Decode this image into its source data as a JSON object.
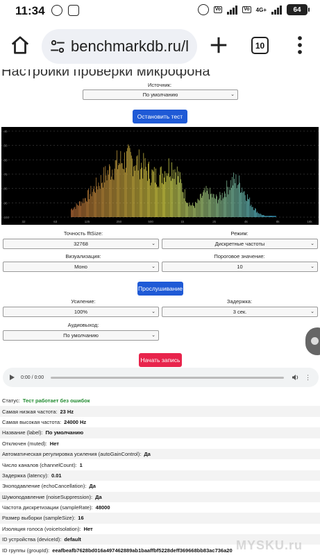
{
  "status_bar": {
    "time": "11:34",
    "battery": "64",
    "network": "4G+"
  },
  "browser": {
    "url": "benchmarkdb.ru/l",
    "tab_count": "10"
  },
  "page": {
    "heading_cut": "Настройки проверки микрофона",
    "source_label": "Источник:",
    "source_value": "По умолчанию",
    "stop_button": "Остановить тест",
    "accuracy_label": "Точность fftSize:",
    "accuracy_value": "32768",
    "mode_label": "Режим:",
    "mode_value": "Дискретные частоты",
    "viz_label": "Визуализация:",
    "viz_value": "Моно",
    "threshold_label": "Пороговое значение:",
    "threshold_value": "10",
    "listen_button": "Прослушивание",
    "gain_label": "Усиление:",
    "gain_value": "100%",
    "delay_label": "Задержка:",
    "delay_value": "3 сек.",
    "output_label": "Аудиовыход:",
    "output_value": "По умолчанию",
    "record_button": "Начать запись",
    "audio_time": "0:00 / 0:00"
  },
  "spectrum": {
    "y_ticks": [
      "-40",
      "-50",
      "-60",
      "-70",
      "-80",
      "-90",
      "-100"
    ],
    "x_ticks": [
      "32",
      "63",
      "125",
      "250",
      "500",
      "1k",
      "2k",
      "4k",
      "8k",
      "16k"
    ],
    "colors": {
      "low": "#c0703a",
      "mid": "#e6e24a",
      "high": "#3fb3e0"
    }
  },
  "info_rows": [
    {
      "label": "Статус:",
      "value": "Тест работает без ошибок",
      "ok": true
    },
    {
      "label": "Самая низкая частота:",
      "value": "23 Hz"
    },
    {
      "label": "Самая высокая частота:",
      "value": "24000 Hz"
    },
    {
      "label": "Название (label):",
      "value": "По умолчанию"
    },
    {
      "label": "Отключен (muted):",
      "value": "Нет"
    },
    {
      "label": "Автоматическая регулировка усиления (autoGainControl):",
      "value": "Да"
    },
    {
      "label": "Число каналов (channelCount):",
      "value": "1"
    },
    {
      "label": "Задержка (latency):",
      "value": "0.01"
    },
    {
      "label": "Эхоподавление (echoCancellation):",
      "value": "Да"
    },
    {
      "label": "Шумоподавление (noiseSuppression):",
      "value": "Да"
    },
    {
      "label": "Частота дискретизации (sampleRate):",
      "value": "48000"
    },
    {
      "label": "Размер выборки (sampleSize):",
      "value": "16"
    },
    {
      "label": "Изоляция голоса (voiceIsolation):",
      "value": "Нет"
    },
    {
      "label": "ID устройства (deviceId):",
      "value": "default"
    },
    {
      "label": "ID группы (groupId):",
      "value": "eeafbeafb7628bd016a497462889ab1baaffbf5228deff369668bb83ac736a20"
    }
  ],
  "watermark": "MYSKU.ru"
}
